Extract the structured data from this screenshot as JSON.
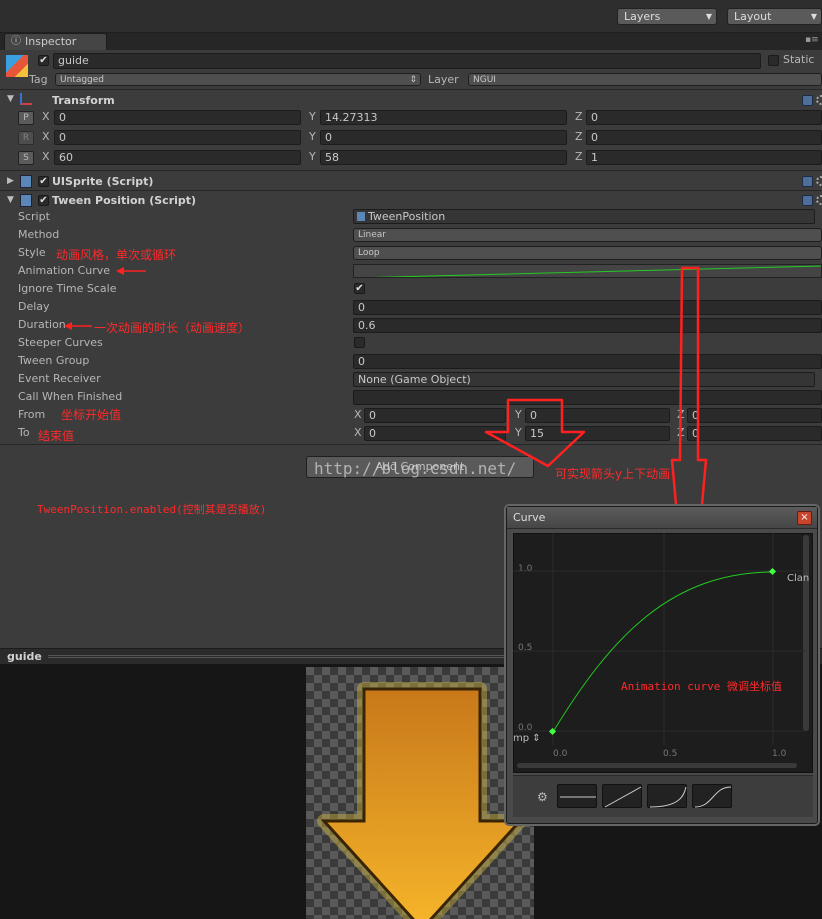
{
  "toolbar": {
    "layers": "Layers",
    "layout": "Layout"
  },
  "tab": {
    "label": "Inspector"
  },
  "object": {
    "name": "guide",
    "static_label": "Static",
    "tag_label": "Tag",
    "tag_value": "Untagged",
    "layer_label": "Layer",
    "layer_value": "NGUI"
  },
  "transform": {
    "title": "Transform",
    "rows": [
      {
        "btn": "P",
        "x": "0",
        "y": "14.27313",
        "z": "0"
      },
      {
        "btn": "R",
        "x": "0",
        "y": "0",
        "z": "0"
      },
      {
        "btn": "S",
        "x": "60",
        "y": "58",
        "z": "1"
      }
    ],
    "axis": {
      "x": "X",
      "y": "Y",
      "z": "Z"
    }
  },
  "uisprite": {
    "title": "UISprite (Script)"
  },
  "tween": {
    "title": "Tween Position (Script)",
    "script_label": "Script",
    "script_value": "TweenPosition",
    "method_label": "Method",
    "method_value": "Linear",
    "style_label": "Style",
    "style_value": "Loop",
    "curve_label": "Animation Curve",
    "ignore_label": "Ignore Time Scale",
    "delay_label": "Delay",
    "delay_value": "0",
    "duration_label": "Duration",
    "duration_value": "0.6",
    "steeper_label": "Steeper Curves",
    "group_label": "Tween Group",
    "group_value": "0",
    "receiver_label": "Event Receiver",
    "receiver_value": "None (Game Object)",
    "call_label": "Call When Finished",
    "from_label": "From",
    "from_x": "0",
    "from_y": "0",
    "from_z": "0",
    "to_label": "To",
    "to_x": "0",
    "to_y": "15",
    "to_z": "0"
  },
  "add_component": "Add Component",
  "watermark": "http://blog.csdn.net/",
  "annotations": {
    "style": "动画风格，单次或循环",
    "duration": "一次动画的时长（动画速度）",
    "from": "坐标开始值",
    "to": "结束值",
    "enabled": "TweenPosition.enabled(控制其是否播放)",
    "arrow": "可实现箭头y上下动画",
    "curve": "Animation curve 微调坐标值"
  },
  "preview": {
    "title": "guide"
  },
  "curve_window": {
    "title": "Curve",
    "y_ticks": [
      "1.0",
      "0.5",
      "0.0"
    ],
    "x_ticks": [
      "0.0",
      "0.5",
      "1.0"
    ],
    "wrap_left": "mp",
    "wrap_right": "Clan"
  },
  "curve_data": {
    "keys": [
      [
        0,
        0
      ],
      [
        1,
        1
      ]
    ],
    "shape": "ease-out"
  },
  "colors": {
    "annotation": "#ff2a2a",
    "curve": "#22cc22",
    "arrow_fill": "#f2a51c"
  }
}
